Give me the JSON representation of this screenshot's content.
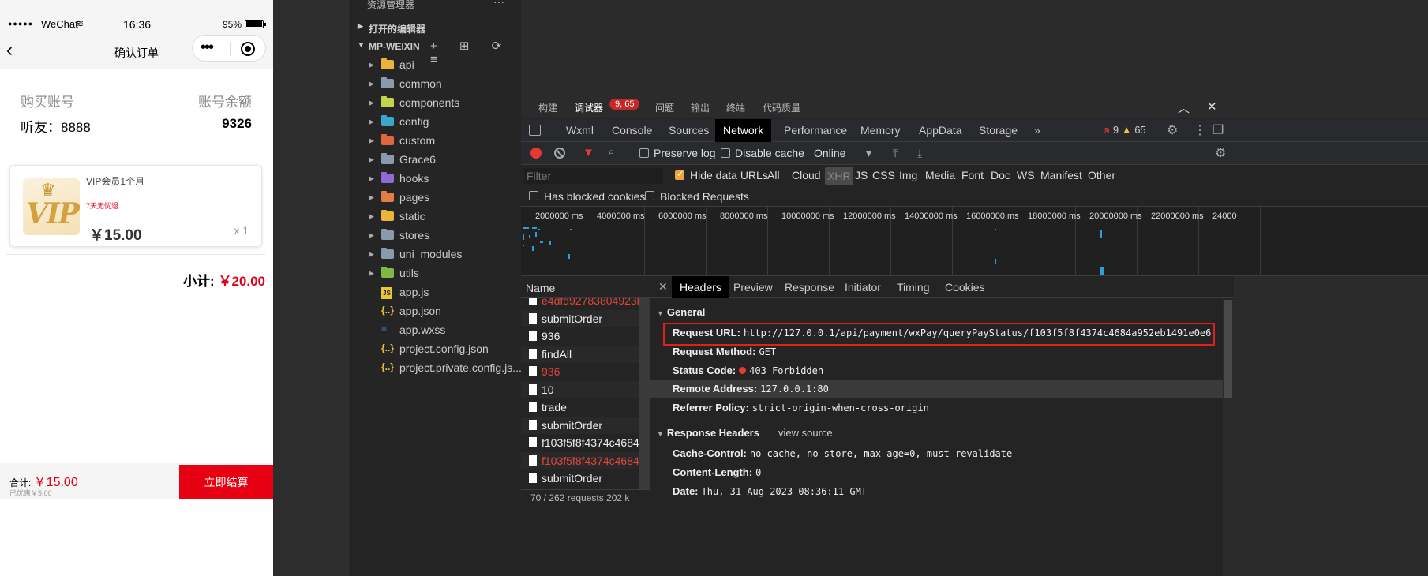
{
  "simulator": {
    "status_bar": {
      "signal": "●●●●●",
      "carrier": "WeChat",
      "wifi": "≋",
      "time": "16:36",
      "battery_pct": "95%"
    },
    "nav": {
      "back": "‹",
      "title": "确认订单",
      "more": "•••"
    },
    "account": {
      "buy_label": "购买账号",
      "balance_label": "账号余额",
      "buy_value": "听友：8888",
      "balance_value": "9326"
    },
    "product": {
      "name": "VIP会员1个月",
      "refund_tag": "7天无忧退",
      "price": "￥15.00",
      "qty": "x 1",
      "logo_text": "VIP",
      "crown": "♛"
    },
    "subtotal_label": "小计: ",
    "subtotal_value": "￥20.00",
    "footer": {
      "total_label": "合计: ",
      "total_value": "￥15.00",
      "discount": "已优惠￥5.00",
      "pay_button": "立即结算"
    }
  },
  "explorer": {
    "header": "资源管理器",
    "header_more": "···",
    "open_editors": "打开的编辑器",
    "project": "MP-WEIXIN",
    "project_actions": "+ ⊞ ⟳ ≡",
    "items": [
      {
        "label": "api",
        "type": "folder",
        "color": "#e8b43a"
      },
      {
        "label": "common",
        "type": "folder",
        "color": "#8a9aad"
      },
      {
        "label": "components",
        "type": "folder",
        "color": "#c3d34a"
      },
      {
        "label": "config",
        "type": "folder",
        "color": "#3aa6c9"
      },
      {
        "label": "custom",
        "type": "folder",
        "color": "#e0663d"
      },
      {
        "label": "Grace6",
        "type": "folder",
        "color": "#8a9aad"
      },
      {
        "label": "hooks",
        "type": "folder",
        "color": "#8d6bd1"
      },
      {
        "label": "pages",
        "type": "folder",
        "color": "#e37b46"
      },
      {
        "label": "static",
        "type": "folder",
        "color": "#e8b43a"
      },
      {
        "label": "stores",
        "type": "folder",
        "color": "#8a9aad"
      },
      {
        "label": "uni_modules",
        "type": "folder",
        "color": "#8a9aad"
      },
      {
        "label": "utils",
        "type": "folder",
        "color": "#7fb847"
      },
      {
        "label": "app.js",
        "type": "file",
        "icon": "JS",
        "color": "#e8c53a"
      },
      {
        "label": "app.json",
        "type": "file",
        "icon": "{..}",
        "color": "#e8c53a"
      },
      {
        "label": "app.wxss",
        "type": "file",
        "icon": "≡",
        "color": "#3a8fdc"
      },
      {
        "label": "project.config.json",
        "type": "file",
        "icon": "{..}",
        "color": "#e8c53a"
      },
      {
        "label": "project.private.config.js...",
        "type": "file",
        "icon": "{..}",
        "color": "#e8c53a"
      }
    ]
  },
  "devtools": {
    "top_tabs": [
      "构建",
      "调试器",
      "问题",
      "输出",
      "终端",
      "代码质量"
    ],
    "badge": "9, 65",
    "window_buttons": {
      "collapse": "︿",
      "close": "✕"
    },
    "panel_tabs": [
      "Wxml",
      "Console",
      "Sources",
      "Network",
      "Performance",
      "Memory",
      "AppData",
      "Storage"
    ],
    "more_tabs": "»",
    "error_count": "9",
    "warning_count": "65",
    "toolbar": {
      "preserve_log": "Preserve log",
      "disable_cache": "Disable cache",
      "throttle": "Online",
      "throttle_arrow": "▾"
    },
    "filter": {
      "placeholder": "Filter",
      "hide_data_urls": "Hide data URLs",
      "types": [
        "All",
        "Cloud",
        "XHR",
        "JS",
        "CSS",
        "Img",
        "Media",
        "Font",
        "Doc",
        "WS",
        "Manifest",
        "Other"
      ],
      "active_type": "XHR"
    },
    "blocked": {
      "has_blocked_cookies": "Has blocked cookies",
      "blocked_requests": "Blocked Requests"
    },
    "timeline_ticks": [
      "2000000 ms",
      "4000000 ms",
      "6000000 ms",
      "8000000 ms",
      "10000000 ms",
      "12000000 ms",
      "14000000 ms",
      "16000000 ms",
      "18000000 ms",
      "20000000 ms",
      "22000000 ms",
      "24000"
    ],
    "name_header": "Name",
    "requests": [
      {
        "name": "e4dfd92783804923b...",
        "error": true
      },
      {
        "name": "submitOrder",
        "error": false
      },
      {
        "name": "936",
        "error": false
      },
      {
        "name": "findAll",
        "error": false
      },
      {
        "name": "936",
        "error": true
      },
      {
        "name": "10",
        "error": false
      },
      {
        "name": "trade",
        "error": false
      },
      {
        "name": "submitOrder",
        "error": false
      },
      {
        "name": "f103f5f8f4374c4684a...",
        "error": false
      },
      {
        "name": "f103f5f8f4374c4684a...",
        "error": true
      },
      {
        "name": "submitOrder",
        "error": false
      }
    ],
    "footer_status": "70 / 262 requests   202 k",
    "detail_tabs": [
      "Headers",
      "Preview",
      "Response",
      "Initiator",
      "Timing",
      "Cookies"
    ],
    "general_title": "General",
    "general": [
      {
        "k": "Request URL:",
        "v": "http://127.0.0.1/api/payment/wxPay/queryPayStatus/f103f5f8f4374c4684a952eb1491e0e6"
      },
      {
        "k": "Request Method:",
        "v": "GET"
      },
      {
        "k": "Status Code:",
        "v": "403 Forbidden"
      },
      {
        "k": "Remote Address:",
        "v": "127.0.0.1:80"
      },
      {
        "k": "Referrer Policy:",
        "v": "strict-origin-when-cross-origin"
      }
    ],
    "response_title": "Response Headers",
    "view_source": "view source",
    "response": [
      {
        "k": "Cache-Control:",
        "v": "no-cache, no-store, max-age=0, must-revalidate"
      },
      {
        "k": "Content-Length:",
        "v": "0"
      },
      {
        "k": "Date:",
        "v": "Thu, 31 Aug 2023 08:36:11 GMT"
      }
    ]
  }
}
